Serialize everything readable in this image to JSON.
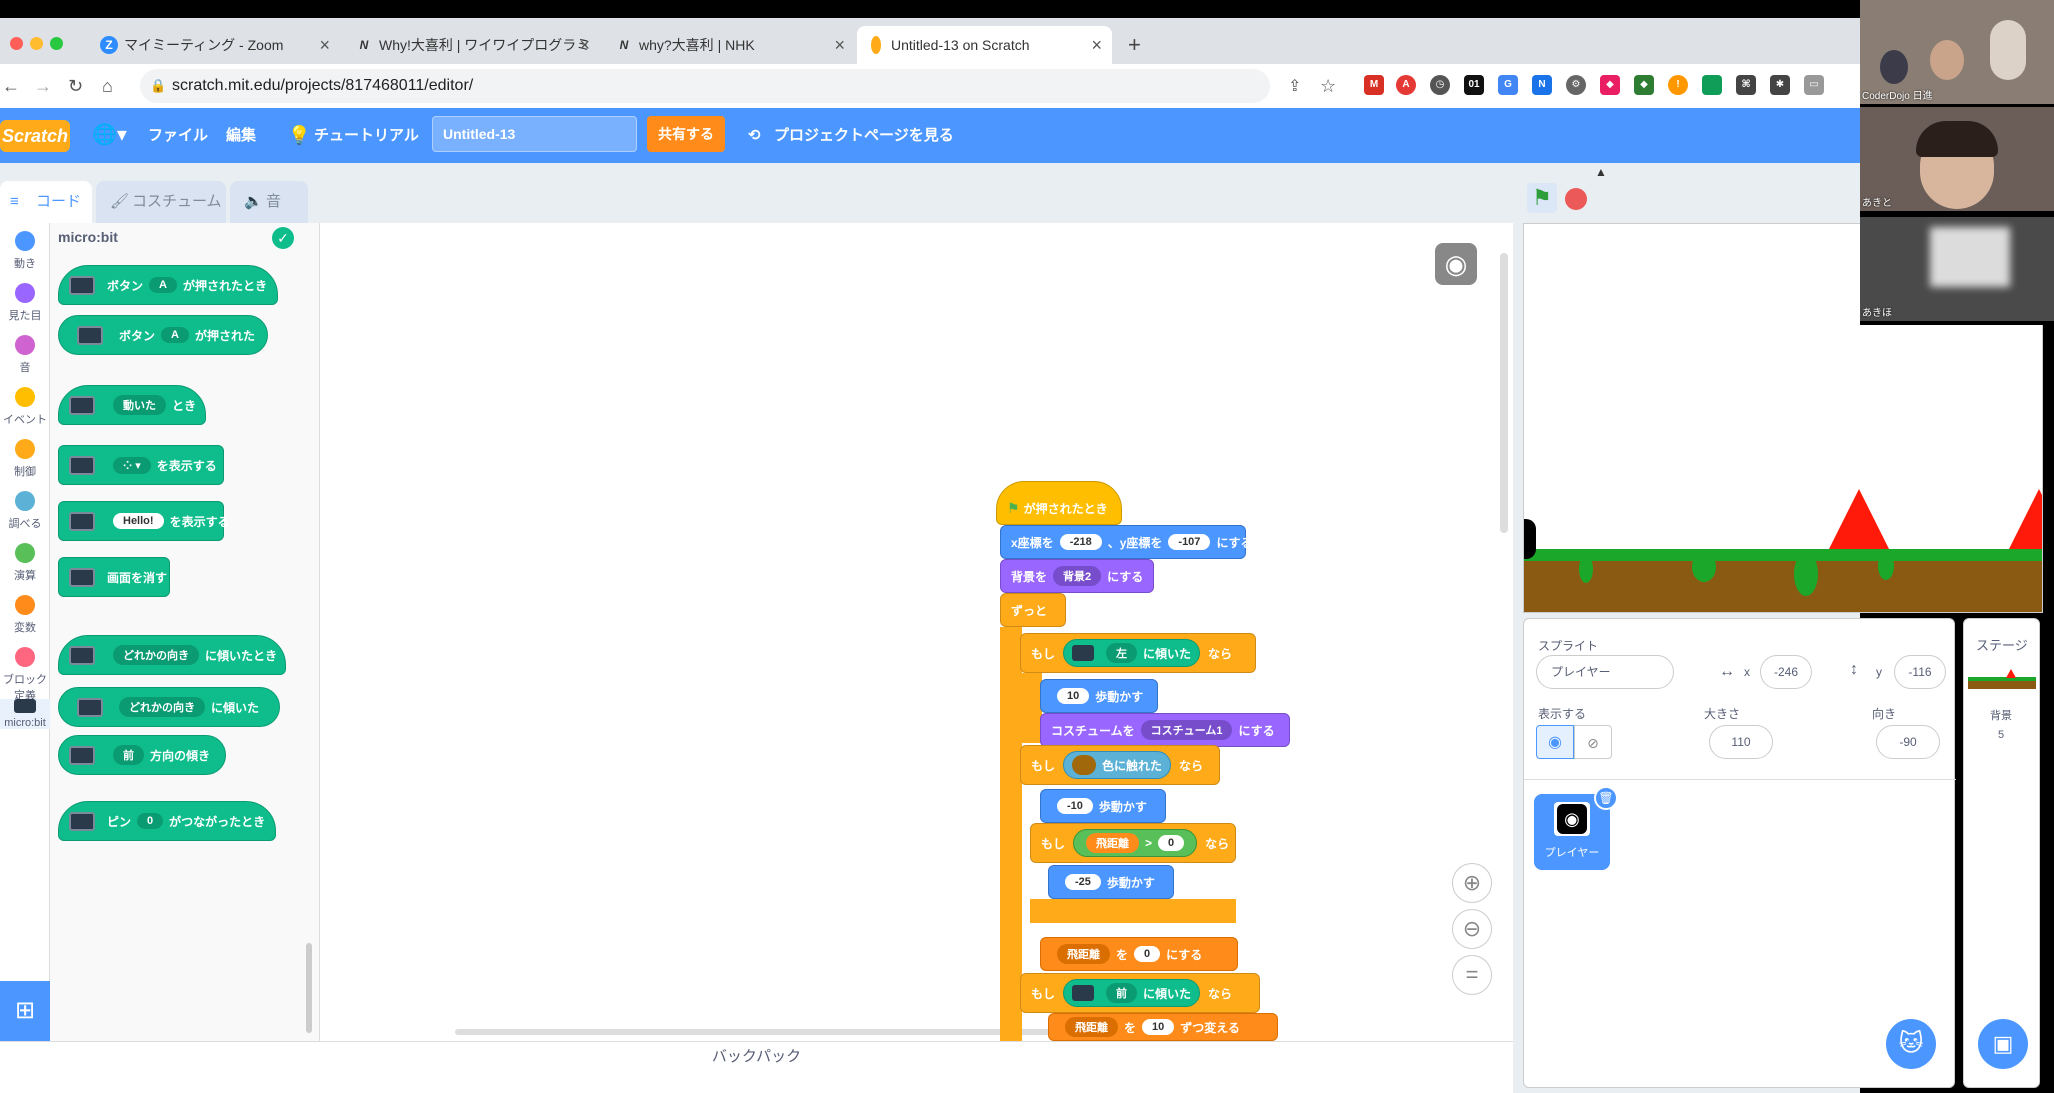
{
  "browser": {
    "tabs": [
      {
        "title": "マイミーティング - Zoom",
        "icon": "Z"
      },
      {
        "title": "Why!大喜利 | ワイワイプログラミ",
        "icon": "N"
      },
      {
        "title": "why?大喜利 | NHK",
        "icon": "N"
      },
      {
        "title": "Untitled-13 on Scratch",
        "icon": "S"
      }
    ],
    "new_tab": "+",
    "url": "scratch.mit.edu/projects/817468011/editor/"
  },
  "menubar": {
    "logo": "Scratch",
    "file": "ファイル",
    "edit": "編集",
    "tutorial": "チュートリアル",
    "project_title": "Untitled-13",
    "share": "共有する",
    "see_project": "プロジェクトページを見る"
  },
  "editor_tabs": {
    "code": "コード",
    "costume": "コスチューム",
    "sound": "音"
  },
  "categories": [
    {
      "label": "動き",
      "color": "#4c97ff"
    },
    {
      "label": "見た目",
      "color": "#9966ff"
    },
    {
      "label": "音",
      "color": "#cf63cf"
    },
    {
      "label": "イベント",
      "color": "#ffbf00"
    },
    {
      "label": "制御",
      "color": "#ffab19"
    },
    {
      "label": "調べる",
      "color": "#5cb1d6"
    },
    {
      "label": "演算",
      "color": "#59c059"
    },
    {
      "label": "変数",
      "color": "#ff8c1a"
    },
    {
      "label": "ブロック定義",
      "color": "#ff6680"
    },
    {
      "label": "micro:bit",
      "color": "#0fbd8c"
    }
  ],
  "palette": {
    "header": "micro:bit",
    "blocks": {
      "b1_pre": "ボタン",
      "b1_dd": "A",
      "b1_post": "が押されたとき",
      "b2_pre": "ボタン",
      "b2_dd": "A",
      "b2_post": "が押された",
      "b3_dd": "動いた",
      "b3_post": "とき",
      "b4_post": "を表示する",
      "b5_pill": "Hello!",
      "b5_post": "を表示する",
      "b6": "画面を消す",
      "b7_dd": "どれかの向き",
      "b7_post": "に傾いたとき",
      "b8_dd": "どれかの向き",
      "b8_post": "に傾いた",
      "b9_dd": "前",
      "b9_post": "方向の傾き",
      "b10_pre": "ピン",
      "b10_dd": "0",
      "b10_post": "がつながったとき"
    }
  },
  "script": {
    "flag_hat": "が押されたとき",
    "goto_x_label": "x座標を",
    "goto_x": "-218",
    "goto_y_label": "、y座標を",
    "goto_y": "-107",
    "goto_end": "にする",
    "backdrop_label": "背景を",
    "backdrop_dd": "背景2",
    "backdrop_end": "にする",
    "forever": "ずっと",
    "if1": "もし",
    "if1_dd": "左",
    "if1_post": "に傾いた",
    "if1_then": "なら",
    "move1": "10",
    "move_label": "歩動かす",
    "costume_label": "コスチュームを",
    "costume_dd": "コスチューム1",
    "costume_end": "にする",
    "if2": "もし",
    "if2_color": "色に触れた",
    "if2_then": "なら",
    "move2": "-10",
    "if3": "もし",
    "if3_var": "飛距離",
    "if3_op": ">",
    "if3_val": "0",
    "if3_then": "なら",
    "move3": "-25",
    "set_var": "飛距離",
    "set_to": "を",
    "set_val": "0",
    "set_end": "にする",
    "if4": "もし",
    "if4_dd": "前",
    "if4_post": "に傾いた",
    "if4_then": "なら",
    "change_var": "飛距離",
    "change_to": "を",
    "change_val": "10",
    "change_end": "ずつ変える"
  },
  "backpack": "バックパック",
  "sprite_info": {
    "sprite_label": "スプライト",
    "name": "プレイヤー",
    "x_label": "x",
    "x": "-246",
    "y_label": "y",
    "y": "-116",
    "show_label": "表示する",
    "size_label": "大きさ",
    "size": "110",
    "direction_label": "向き",
    "direction": "-90",
    "thumb_name": "プレイヤー"
  },
  "stage_pane": {
    "title": "ステージ",
    "backdrop_label": "背景",
    "count": "5"
  },
  "video": [
    {
      "name": "CoderDojo 日進"
    },
    {
      "name": "あきと"
    },
    {
      "name": "あきほ"
    }
  ]
}
